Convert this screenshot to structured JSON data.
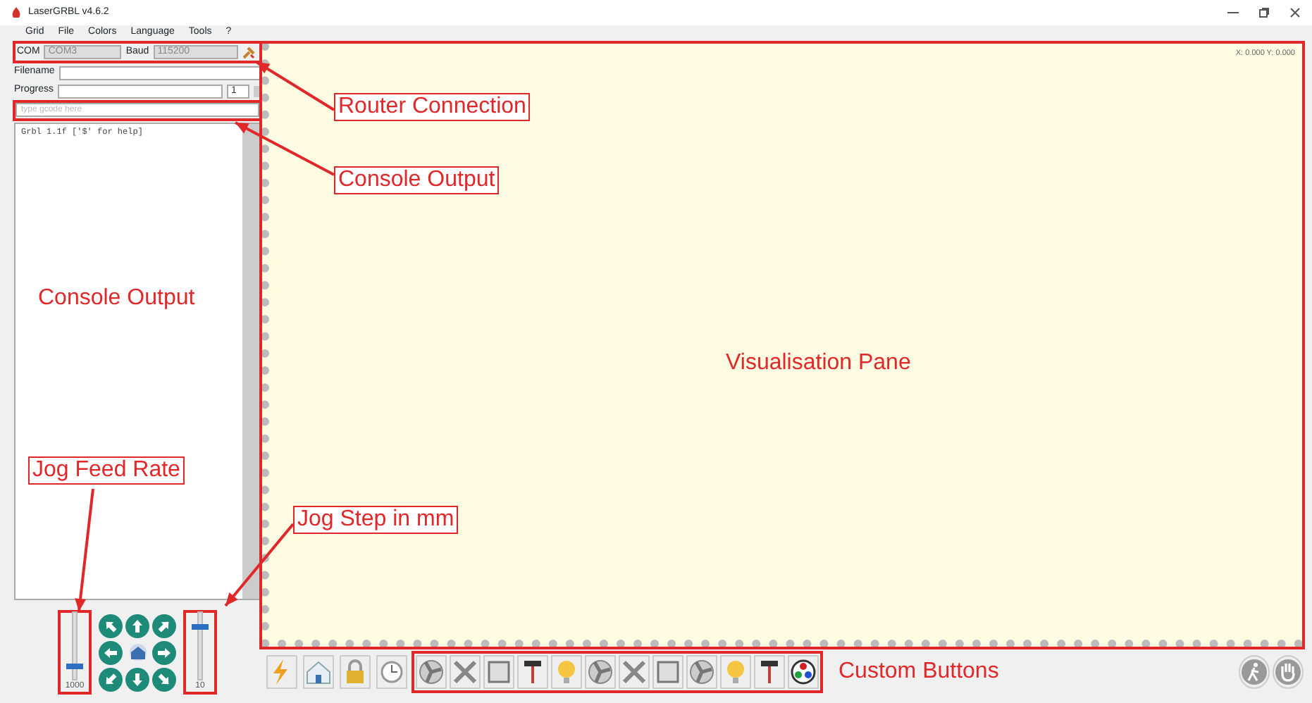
{
  "window": {
    "title": "LaserGRBL v4.6.2"
  },
  "menu": [
    "Grid",
    "File",
    "Colors",
    "Language",
    "Tools",
    "?"
  ],
  "connection": {
    "com_label": "COM",
    "com_value": "COM3",
    "baud_label": "Baud",
    "baud_value": "115200"
  },
  "file": {
    "filename_label": "Filename",
    "progress_label": "Progress",
    "passes": "1",
    "level": 0
  },
  "command": {
    "placeholder": "type gcode here"
  },
  "console": [
    "Grbl 1.1f ['$' for help]"
  ],
  "jog": {
    "feed": {
      "level": 0.15,
      "value": "1000"
    },
    "step": {
      "level": 0.8,
      "value": "10"
    }
  },
  "preview": {
    "coords": "X: 0.000 Y: 0.000"
  },
  "toolbar": {
    "left": [
      {
        "kind": "bolt"
      },
      {
        "kind": "home"
      },
      {
        "kind": "lock"
      },
      {
        "kind": "clock"
      }
    ],
    "custom": [
      {
        "kind": "fan"
      },
      {
        "kind": "cross"
      },
      {
        "kind": "frame"
      },
      {
        "kind": "brush"
      },
      {
        "kind": "bulb"
      },
      {
        "kind": "fan"
      },
      {
        "kind": "cross"
      },
      {
        "kind": "frame"
      },
      {
        "kind": "fan"
      },
      {
        "kind": "bulb"
      },
      {
        "kind": "brush"
      },
      {
        "kind": "wheel"
      }
    ],
    "right": [
      {
        "kind": "walk"
      },
      {
        "kind": "hand"
      }
    ]
  },
  "annotations": {
    "router_connection": "Router Connection",
    "console_output_arrow": "Console Output",
    "console_output": "Console Output",
    "visualisation_pane": "Visualisation Pane",
    "jog_feed_rate": "Jog Feed Rate",
    "jog_step": "Jog Step in mm",
    "custom_buttons": "Custom Buttons"
  }
}
